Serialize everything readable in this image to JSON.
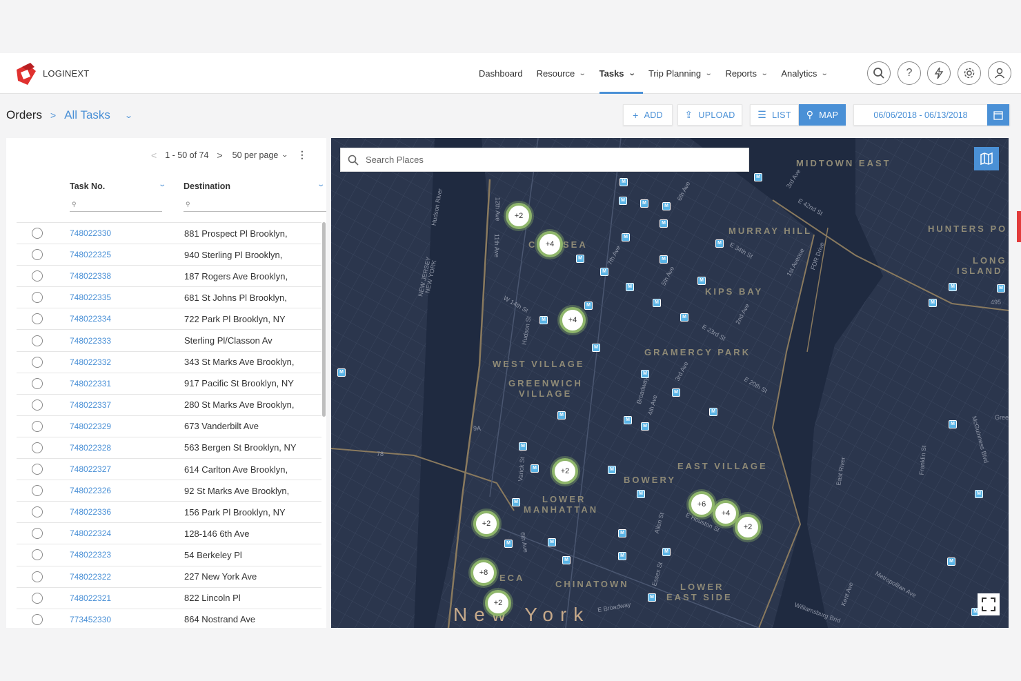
{
  "app": {
    "brand": "LOGINEXT"
  },
  "nav": {
    "items": [
      {
        "label": "Dashboard",
        "has_menu": false
      },
      {
        "label": "Resource",
        "has_menu": true
      },
      {
        "label": "Tasks",
        "has_menu": true,
        "active": true
      },
      {
        "label": "Trip Planning",
        "has_menu": true
      },
      {
        "label": "Reports",
        "has_menu": true
      },
      {
        "label": "Analytics",
        "has_menu": true
      }
    ],
    "icons": [
      "search-icon",
      "help-icon",
      "lightning-icon",
      "settings-icon",
      "user-icon"
    ]
  },
  "breadcrumb": {
    "root": "Orders",
    "current": "All Tasks"
  },
  "toolbar": {
    "add_label": "ADD",
    "upload_label": "UPLOAD",
    "list_label": "LIST",
    "map_label": "MAP",
    "date_range": "06/06/2018 - 06/13/2018"
  },
  "list": {
    "pagination": {
      "range": "1 - 50 of 74",
      "per_page": "50 per page"
    },
    "columns": {
      "task_no": "Task No.",
      "destination": "Destination"
    },
    "rows": [
      {
        "task_no": "748022330",
        "destination": "881 Prospect Pl Brooklyn,"
      },
      {
        "task_no": "748022325",
        "destination": "940 Sterling Pl Brooklyn,"
      },
      {
        "task_no": "748022338",
        "destination": "187 Rogers Ave Brooklyn,"
      },
      {
        "task_no": "748022335",
        "destination": "681 St Johns Pl Brooklyn,"
      },
      {
        "task_no": "748022334",
        "destination": "722 Park Pl Brooklyn, NY"
      },
      {
        "task_no": "748022333",
        "destination": "Sterling Pl/Classon Av"
      },
      {
        "task_no": "748022332",
        "destination": "343 St Marks Ave Brooklyn,"
      },
      {
        "task_no": "748022331",
        "destination": "917 Pacific St Brooklyn, NY"
      },
      {
        "task_no": "748022337",
        "destination": "280 St Marks Ave Brooklyn,"
      },
      {
        "task_no": "748022329",
        "destination": "673 Vanderbilt Ave"
      },
      {
        "task_no": "748022328",
        "destination": "563 Bergen St Brooklyn, NY"
      },
      {
        "task_no": "748022327",
        "destination": "614 Carlton Ave Brooklyn,"
      },
      {
        "task_no": "748022326",
        "destination": "92 St Marks Ave Brooklyn,"
      },
      {
        "task_no": "748022336",
        "destination": "156 Park Pl Brooklyn, NY"
      },
      {
        "task_no": "748022324",
        "destination": "128-146 6th Ave"
      },
      {
        "task_no": "748022323",
        "destination": "54 Berkeley Pl"
      },
      {
        "task_no": "748022322",
        "destination": "227 New York Ave"
      },
      {
        "task_no": "748022321",
        "destination": "822 Lincoln Pl"
      },
      {
        "task_no": "773452330",
        "destination": "864 Nostrand Ave"
      }
    ]
  },
  "map": {
    "search_placeholder": "Search Places",
    "clusters": [
      "+2",
      "+4",
      "+4",
      "+2",
      "+2",
      "+8",
      "+2",
      "+6",
      "+4",
      "+2"
    ],
    "area_labels": [
      "MIDTOWN EAST",
      "MURRAY HILL",
      "HUNTERS PO",
      "KIPS BAY",
      "GRAMERCY PARK",
      "WEST VILLAGE",
      "GREENWICH",
      "VILLAGE",
      "EAST VILLAGE",
      "BOWERY",
      "LOWER",
      "MANHATTAN",
      "CHINATOWN",
      "LOWER",
      "EAST SIDE",
      "LONG",
      "ISLAND",
      "C",
      "SEA",
      "ECA"
    ],
    "street_labels": [
      "3rd Ave",
      "E 42nd St",
      "E 34th St",
      "1st Avenue",
      "FDR Drive",
      "W 14th St",
      "Hudson St",
      "E 23rd St",
      "2nd Ave",
      "E 20th St",
      "3rd Ave",
      "Broadway",
      "4th Ave",
      "5th Ave",
      "6th Ave",
      "7th Ave",
      "11th Ave",
      "12th Ave",
      "Varick St",
      "6th Ave",
      "Allen St",
      "Essex St",
      "E Broadway",
      "Metropolitan Ave",
      "Kent Ave",
      "Franklin St",
      "McGuinness Blvd",
      "Williamsburg Brid",
      "NEW JERSEY",
      "NEW YORK",
      "E Houston St",
      "East River",
      "Hudson River",
      "495",
      "9A",
      "78",
      "Gree"
    ],
    "city_label": "New York"
  },
  "colors": {
    "accent": "#4a90d6",
    "map_bg": "#27324a",
    "cluster_ring": "#8fb66b",
    "marker": "#5ab4e6"
  }
}
